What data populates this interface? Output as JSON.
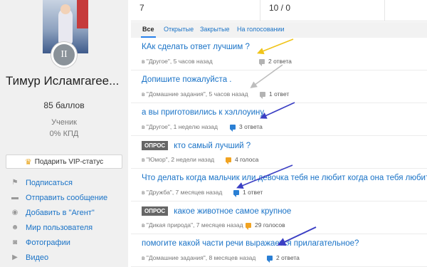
{
  "profile": {
    "name": "Тимур Исламгаree...",
    "points": "85 баллов",
    "status": "Ученик",
    "kpd": "0% КПД",
    "rank_numeral": "II",
    "vip_label": "Подарить VIP-статус"
  },
  "menu": [
    {
      "label": "Подписаться",
      "icon": "flag-icon"
    },
    {
      "label": "Отправить сообщение",
      "icon": "message-icon"
    },
    {
      "label": "Добавить в \"Агент\"",
      "icon": "agent-icon"
    },
    {
      "label": "Мир пользователя",
      "icon": "person-icon"
    },
    {
      "label": "Фотографии",
      "icon": "camera-icon"
    },
    {
      "label": "Видео",
      "icon": "video-icon"
    }
  ],
  "stats": {
    "left_value": "7",
    "right_value": "10 / 0"
  },
  "tabs": [
    {
      "label": "Все",
      "active": true
    },
    {
      "label": "Открытые",
      "active": false
    },
    {
      "label": "Закрытые",
      "active": false
    },
    {
      "label": "На голосовании",
      "active": false
    }
  ],
  "questions": [
    {
      "badge": "",
      "title": "КАк сделать ответ лучшим ?",
      "meta": "в \"Другое\", 5 часов назад",
      "answers": "2 ответа",
      "icon_color": "gray"
    },
    {
      "badge": "",
      "title": "Допишите пожалуйста .",
      "meta": "в \"Домашние задания\", 5 часов назад",
      "answers": "1 ответ",
      "icon_color": "gray"
    },
    {
      "badge": "",
      "title": "а вы приготовились к хэллоуину",
      "meta": "в \"Другое\", 1 неделю назад",
      "answers": "3 ответа",
      "icon_color": "blue"
    },
    {
      "badge": "ОПРОС",
      "title": "кто самый лучший ?",
      "meta": "в \"Юмор\", 2 недели назад",
      "answers": "4 голоса",
      "icon_color": "orange"
    },
    {
      "badge": "",
      "title": "Что делать когда мальчик или девочка тебя не любит когда она тебя любит",
      "meta": "в \"Дружба\", 7 месяцев назад",
      "answers": "1 ответ",
      "icon_color": "blue"
    },
    {
      "badge": "ОПРОС",
      "title": "какое животное самое крупное",
      "meta": "в \"Дикая природа\", 7 месяцев назад",
      "answers": "29 голосов",
      "icon_color": "orange"
    },
    {
      "badge": "",
      "title": "помогите какой части речи выражается прилагательное?",
      "meta": "в \"Домашние задания\", 8 месяцев назад",
      "answers": "2 ответа",
      "icon_color": "blue"
    }
  ],
  "colors": {
    "link": "#1a73c7",
    "accent_blue": "#2680eb",
    "arrow_yellow": "#f0c419",
    "arrow_gray": "#bdbdbd",
    "arrow_blue": "#3b3fc4"
  }
}
